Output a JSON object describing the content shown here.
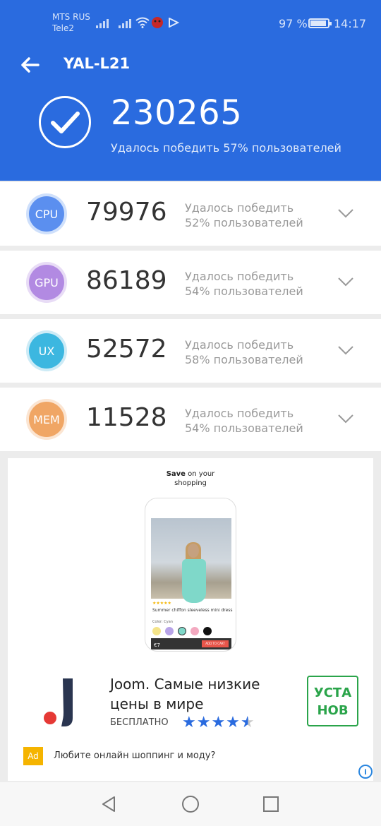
{
  "status_bar": {
    "carrier_1": "MTS RUS",
    "carrier_2": "Tele2",
    "battery": "97 %",
    "time": "14:17",
    "icons": [
      "signal-icon",
      "signal-icon",
      "wifi-icon",
      "notification-icon",
      "play-icon",
      "battery-icon"
    ]
  },
  "header": {
    "device": "YAL-L21",
    "total_score": "230265",
    "beat_text": "Удалось победить 57% пользователей",
    "color": "#2a6bdf"
  },
  "scores": [
    {
      "label": "CPU",
      "value": "79976",
      "line1": "Удалось победить",
      "line2": "52% пользователей",
      "color": "#5b8fef",
      "ring": "#cfe0fb"
    },
    {
      "label": "GPU",
      "value": "86189",
      "line1": "Удалось победить",
      "line2": "54% пользователей",
      "color": "#b28ae2",
      "ring": "#e8dcf6"
    },
    {
      "label": "UX",
      "value": "52572",
      "line1": "Удалось победить",
      "line2": "58% пользователей",
      "color": "#3cb7e0",
      "ring": "#cdebf6"
    },
    {
      "label": "MEM",
      "value": "11528",
      "line1": "Удалось победить",
      "line2": "54% пользователей",
      "color": "#f0a665",
      "ring": "#fbe5d2"
    }
  ],
  "ad": {
    "top_bold": "Save",
    "top_rest": " on your",
    "top_line2": "shopping",
    "phone_text": "Summer chiffon sleeveless mini dress",
    "phone_color": "Color: Cyan",
    "phone_price": "€7",
    "phone_cart": "ADD TO CART",
    "title": "Joom. Самые низкие цены в мире",
    "free": "БЕСПЛАТНО",
    "rating": 4.5,
    "install": "УСТА НОВ",
    "badge": "Ad",
    "footer": "Любите онлайн шоппинг и моду?",
    "info": "i"
  },
  "navbar": {
    "icons": [
      "back-triangle-icon",
      "home-circle-icon",
      "recents-square-icon"
    ]
  }
}
